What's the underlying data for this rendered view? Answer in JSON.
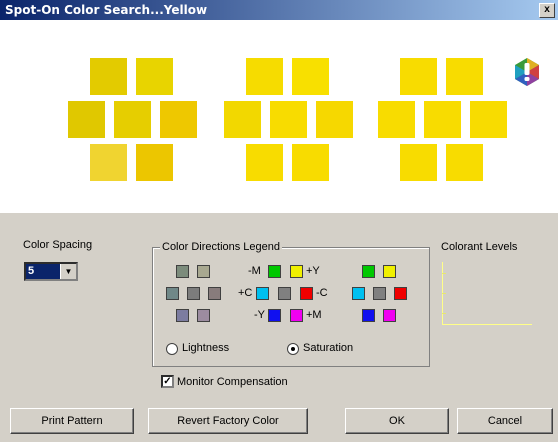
{
  "window": {
    "title": "Spot-On Color Search...Yellow",
    "close_label": "x"
  },
  "swatch_colors": {
    "left": [
      "#e3cb00",
      "#e8d400",
      "#e0c800",
      "#e6ce00",
      "#eec800",
      "#f0d430",
      "#ecc600"
    ],
    "middle": [
      "#f6dc00",
      "#f8e000",
      "#f2d800",
      "#f8dc00",
      "#f6d800",
      "#f8dc00",
      "#f8dc00"
    ],
    "right": [
      "#f8dc00",
      "#f8dc00",
      "#f8dc00",
      "#f8dc00",
      "#f8dc00",
      "#f8dc00",
      "#f8dc00"
    ]
  },
  "color_spacing": {
    "label": "Color Spacing",
    "value": "5"
  },
  "legend": {
    "title": "Color Directions Legend",
    "labels": {
      "minus_m": "-M",
      "plus_y": "+Y",
      "plus_c": "+C",
      "minus_c": "-C",
      "minus_y": "-Y",
      "plus_m": "+M"
    },
    "colors": {
      "gray_a": "#7c8c7c",
      "gray_b": "#a8a890",
      "gray_c": "#708888",
      "gray_d": "#7c7c7c",
      "gray_e": "#887c7c",
      "gray_f": "#7c7ca0",
      "gray_g": "#9c8ca0",
      "green": "#00c800",
      "yellow": "#f0f000",
      "cyan": "#00c0f0",
      "red": "#f00000",
      "blue": "#1010f0",
      "magenta": "#f000f0",
      "mid_gray": "#808080"
    }
  },
  "mode": {
    "lightness_label": "Lightness",
    "saturation_label": "Saturation",
    "selected": "Saturation"
  },
  "colorant_levels": {
    "label": "Colorant Levels"
  },
  "monitor_compensation": {
    "label": "Monitor Compensation",
    "checked": true,
    "check_mark": "✓"
  },
  "buttons": {
    "print_pattern": "Print Pattern",
    "revert_factory_color": "Revert Factory Color",
    "ok": "OK",
    "cancel": "Cancel"
  }
}
